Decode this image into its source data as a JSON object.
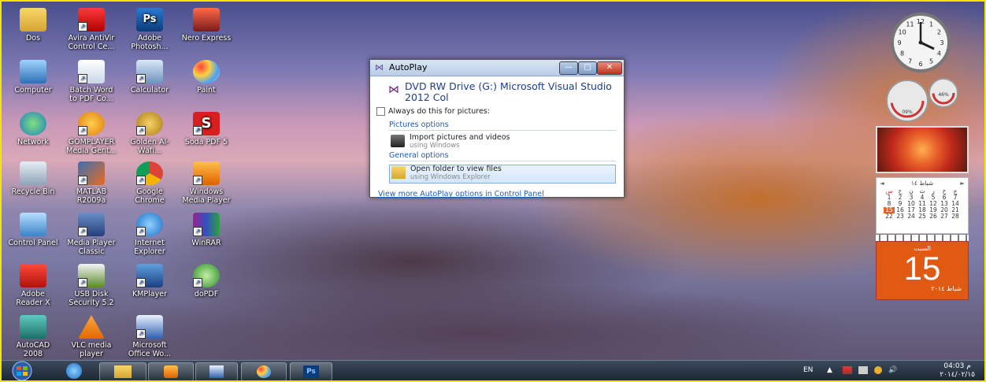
{
  "desktop": {
    "icons": [
      {
        "label": "Dos"
      },
      {
        "label": "Avira AntiVir Control Ce..."
      },
      {
        "label": "Adobe Photosh..."
      },
      {
        "label": "Nero Express"
      },
      {
        "label": "Computer"
      },
      {
        "label": "Batch Word to PDF Co..."
      },
      {
        "label": "Calculator"
      },
      {
        "label": "Paint"
      },
      {
        "label": "Network"
      },
      {
        "label": "GOMPLAYER Media Gent..."
      },
      {
        "label": "Golden Al-Wafi..."
      },
      {
        "label": "Soda PDF 5"
      },
      {
        "label": "Recycle Bin"
      },
      {
        "label": "MATLAB R2009a"
      },
      {
        "label": "Google Chrome"
      },
      {
        "label": "Windows Media Player"
      },
      {
        "label": "Control Panel"
      },
      {
        "label": "Media Player Classic"
      },
      {
        "label": "Internet Explorer"
      },
      {
        "label": "WinRAR"
      },
      {
        "label": "Adobe Reader X"
      },
      {
        "label": "USB Disk Security 5.2"
      },
      {
        "label": "KMPlayer"
      },
      {
        "label": "doPDF"
      },
      {
        "label": "AutoCAD 2008"
      },
      {
        "label": "VLC media player"
      },
      {
        "label": "Microsoft Office Wo..."
      }
    ]
  },
  "dialog": {
    "title": "AutoPlay",
    "minimize": "—",
    "maximize": "□",
    "close": "✕",
    "drive_title": "DVD RW Drive (G:) Microsoft Visual Studio 2012 Col",
    "always_label": "Always do this for pictures:",
    "pictures_section": "Pictures options",
    "import_title": "Import pictures and videos",
    "import_sub": "using Windows",
    "general_section": "General options",
    "open_title": "Open folder to view files",
    "open_sub": "using Windows Explorer",
    "link": "View more AutoPlay options in Control Panel"
  },
  "gadgets": {
    "clock_numbers": [
      "12",
      "1",
      "2",
      "3",
      "4",
      "5",
      "6",
      "7",
      "8",
      "9",
      "10",
      "11"
    ],
    "meter_cpu": "09%",
    "meter_mem": "46%",
    "calendar": {
      "month": "شباط ١٤",
      "prev": "◄",
      "next": "►",
      "weekdays": [
        "س",
        "ح",
        "ن",
        "ث",
        "ر",
        "خ",
        "ج"
      ],
      "rows": [
        [
          "1",
          "2",
          "3",
          "4",
          "5",
          "6",
          "7"
        ],
        [
          "8",
          "9",
          "10",
          "11",
          "12",
          "13",
          "14"
        ],
        [
          "15",
          "16",
          "17",
          "18",
          "19",
          "20",
          "21"
        ],
        [
          "22",
          "23",
          "24",
          "25",
          "26",
          "27",
          "28"
        ]
      ]
    },
    "day": {
      "weekday": "السبت",
      "number": "15",
      "month_year": "شباط ٢٠١٤"
    }
  },
  "taskbar": {
    "lang": "EN",
    "time": "04:03 م",
    "date": "٢٠١٤/٠٢/١٥",
    "up_arrow": "▲",
    "volume": "🔊"
  },
  "colors": {
    "accent": "#1e5bb8",
    "border": "#f4e600",
    "daycard": "#e05a14"
  }
}
